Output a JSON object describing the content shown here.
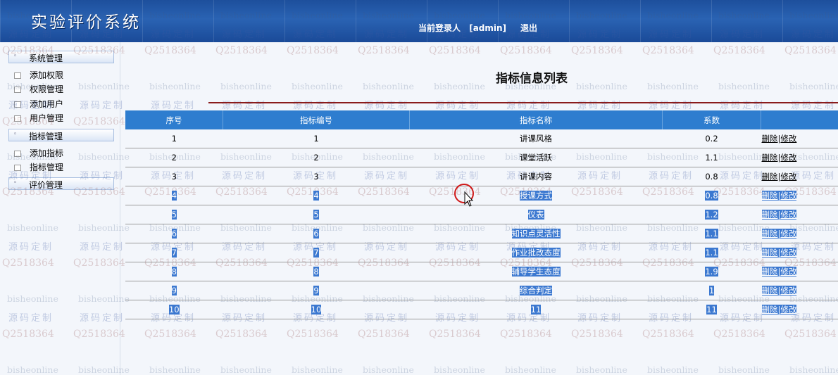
{
  "header": {
    "app_title": "实验评价系统",
    "login_label": "当前登录人",
    "login_user": "[admin]",
    "logout_label": "退出"
  },
  "sidebar": {
    "groups": [
      {
        "label": "系统管理",
        "items": [
          "添加权限",
          "权限管理",
          "添加用户",
          "用户管理"
        ]
      },
      {
        "label": "指标管理",
        "items": [
          "添加指标",
          "指标管理"
        ]
      },
      {
        "label": "评价管理",
        "items": []
      }
    ]
  },
  "main": {
    "title": "指标信息列表",
    "columns": [
      "序号",
      "指标编号",
      "指标名称",
      "系数"
    ],
    "delete_label": "删除",
    "edit_label": "修改",
    "rows": [
      {
        "seq": "1",
        "code": "1",
        "name": "讲课风格",
        "coef": "0.2",
        "selected": false
      },
      {
        "seq": "2",
        "code": "2",
        "name": "课堂活跃",
        "coef": "1.1",
        "selected": false
      },
      {
        "seq": "3",
        "code": "3",
        "name": "讲课内容",
        "coef": "0.8",
        "selected": false
      },
      {
        "seq": "4",
        "code": "4",
        "name": "授课方式",
        "coef": "0.8",
        "selected": true
      },
      {
        "seq": "5",
        "code": "5",
        "name": "仪表",
        "coef": "1.2",
        "selected": true
      },
      {
        "seq": "6",
        "code": "6",
        "name": "知识点灵活性",
        "coef": "1.1",
        "selected": true
      },
      {
        "seq": "7",
        "code": "7",
        "name": "作业批改态度",
        "coef": "1.1",
        "selected": true
      },
      {
        "seq": "8",
        "code": "8",
        "name": "辅导学生态度",
        "coef": "1.9",
        "selected": true
      },
      {
        "seq": "9",
        "code": "9",
        "name": "综合判定",
        "coef": "1",
        "selected": true
      },
      {
        "seq": "10",
        "code": "10",
        "name": "11",
        "coef": "11",
        "selected": true
      }
    ]
  },
  "watermarks": {
    "en": "bisheonline",
    "num": "Q2518364",
    "cn": "源码定制"
  }
}
